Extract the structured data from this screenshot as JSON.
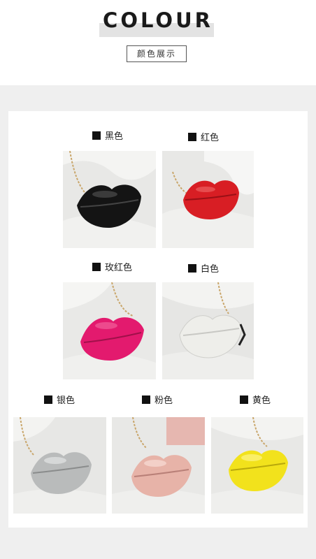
{
  "header": {
    "title": "COLOUR",
    "subtitle": "颜色展示"
  },
  "colors": {
    "black": {
      "label": "黑色",
      "fill": "#141414"
    },
    "red": {
      "label": "红色",
      "fill": "#d81e24"
    },
    "rose_red": {
      "label": "玫红色",
      "fill": "#e31a6e"
    },
    "white": {
      "label": "白色",
      "fill": "#eeeeea"
    },
    "silver": {
      "label": "银色",
      "fill": "#b9bbbb"
    },
    "pink": {
      "label": "粉色",
      "fill": "#e7b3a8"
    },
    "yellow": {
      "label": "黄色",
      "fill": "#f2e21c"
    }
  }
}
